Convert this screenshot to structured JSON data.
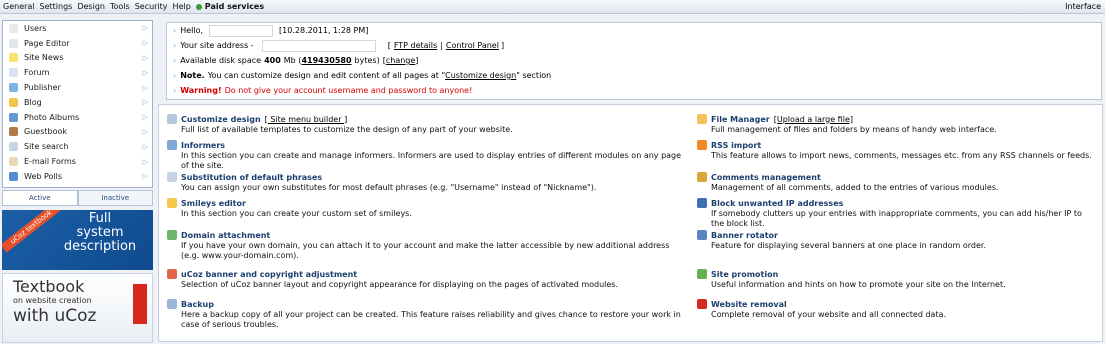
{
  "topbar": {
    "menu": [
      "General",
      "Settings",
      "Design",
      "Tools",
      "Security",
      "Help"
    ],
    "paid": "Paid services",
    "interface": "Interface"
  },
  "sidebar": {
    "items": [
      {
        "label": "Users",
        "icon": "user-icon",
        "color": "#e9e9e9"
      },
      {
        "label": "Page Editor",
        "icon": "page-icon",
        "color": "#dfe6ee"
      },
      {
        "label": "Site News",
        "icon": "bulb-icon",
        "color": "#f7e46b"
      },
      {
        "label": "Forum",
        "icon": "forum-icon",
        "color": "#d7e3f3"
      },
      {
        "label": "Publisher",
        "icon": "publisher-icon",
        "color": "#7fb3e8"
      },
      {
        "label": "Blog",
        "icon": "blog-icon",
        "color": "#f0c54a"
      },
      {
        "label": "Photo Albums",
        "icon": "photo-icon",
        "color": "#5f9bd3"
      },
      {
        "label": "Guestbook",
        "icon": "book-icon",
        "color": "#b07a48"
      },
      {
        "label": "Site search",
        "icon": "search-icon",
        "color": "#c7d4e4"
      },
      {
        "label": "E-mail Forms",
        "icon": "mail-icon",
        "color": "#e8d9b4"
      },
      {
        "label": "Web Polls",
        "icon": "poll-icon",
        "color": "#4f8ed4"
      }
    ],
    "tabs": [
      "Active",
      "Inactive"
    ]
  },
  "banners": {
    "b1_ribbon": "uCoz textbook",
    "b1_text": [
      "Full",
      "system",
      "description"
    ],
    "b2_line1": "Textbook",
    "b2_line2": "on website creation",
    "b2_line3": "with uCoz"
  },
  "info": {
    "hello": "Hello,",
    "date": "[10.28.2011, 1:28 PM]",
    "address_label": "Your site address -",
    "ftp": "FTP details",
    "sep": "|",
    "control_panel": "Control Panel",
    "disk_label": "Available disk space",
    "disk_mb": "400",
    "disk_mb_unit": "Mb (",
    "disk_bytes": "419430580",
    "disk_bytes_unit": "bytes)",
    "change": "change",
    "note_label": "Note.",
    "note_text": "You can customize design and edit content of all pages at \"",
    "note_link": "Customize design",
    "note_end": "\" section",
    "warning_label": "Warning!",
    "warning_text": "Do not give your account username and password to anyone!"
  },
  "left_entries": [
    {
      "title": "Customize design",
      "extra": "[ Site menu builder ]",
      "desc": "Full list of available templates to customize the design of any part of your website.",
      "icon": "design-icon",
      "color": "#b6c7dc"
    },
    {
      "title": "Informers",
      "extra": "",
      "desc": "In this section you can create and manage informers. Informers are used to display entries of different modules on any page of the site.",
      "icon": "informers-icon",
      "color": "#7fa6d6"
    },
    {
      "title": "Substitution of default phrases",
      "extra": "",
      "desc": "You can assign your own substitutes for most default phrases (e.g. \"Username\" instead of \"Nickname\").",
      "icon": "phrases-icon",
      "color": "#c8d4e3"
    },
    {
      "title": "Smileys editor",
      "extra": "",
      "desc": "In this section you can create your custom set of smileys.",
      "icon": "smiley-icon",
      "color": "#f6c84a"
    },
    {
      "title": "Domain attachment",
      "extra": "",
      "desc": "If you have your own domain, you can attach it to your account and make the latter accessible by new additional address (e.g. www.your-domain.com).",
      "icon": "domain-icon",
      "color": "#6db56a"
    },
    {
      "title": "uCoz banner and copyright adjustment",
      "extra": "",
      "desc": "Selection of uCoz banner layout and copyright appearance for displaying on the pages of activated modules.",
      "icon": "banner-icon",
      "color": "#e0664a"
    },
    {
      "title": "Backup",
      "extra": "",
      "desc": "Here a backup copy of all your project can be created. This feature raises reliability and gives chance to restore your work in case of serious troubles.",
      "icon": "backup-icon",
      "color": "#9bb6d8"
    }
  ],
  "right_entries": [
    {
      "title": "File Manager",
      "extra": "[Upload a large file]",
      "desc": "Full management of files and folders by means of handy web interface.",
      "icon": "folder-icon",
      "color": "#f1c35a"
    },
    {
      "title": "RSS import",
      "extra": "",
      "desc": "This feature allows to import news, comments, messages etc. from any RSS channels or feeds.",
      "icon": "rss-icon",
      "color": "#f08a24"
    },
    {
      "title": "Comments management",
      "extra": "",
      "desc": "Management of all comments, added to the entries of various modules.",
      "icon": "comments-icon",
      "color": "#d9a73a"
    },
    {
      "title": "Block unwanted IP addresses",
      "extra": "",
      "desc": "If somebody clutters up your entries with inappropriate comments, you can add his/her IP to the block list.",
      "icon": "block-icon",
      "color": "#3f6fb0"
    },
    {
      "title": "Banner rotator",
      "extra": "",
      "desc": "Feature for displaying several banners at one place in random order.",
      "icon": "rotator-icon",
      "color": "#5b86c3"
    },
    {
      "title": "Site promotion",
      "extra": "",
      "desc": "Useful information and hints on how to promote your site on the Internet.",
      "icon": "promotion-icon",
      "color": "#6ab04c"
    },
    {
      "title": "Website removal",
      "extra": "",
      "desc": "Complete removal of your website and all connected data.",
      "icon": "close-icon",
      "color": "#d32b1e"
    }
  ]
}
